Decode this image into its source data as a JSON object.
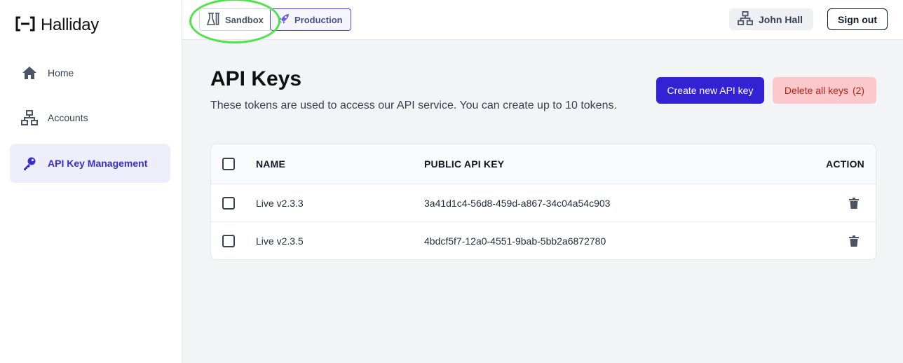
{
  "brand": {
    "name": "Halliday"
  },
  "sidebar": {
    "items": [
      {
        "label": "Home",
        "icon": "home-icon",
        "active": false
      },
      {
        "label": "Accounts",
        "icon": "network-icon",
        "active": false
      },
      {
        "label": "API Key Management",
        "icon": "key-icon",
        "active": true
      }
    ]
  },
  "topbar": {
    "env": {
      "sandbox_label": "Sandbox",
      "production_label": "Production"
    },
    "user_name": "John Hall",
    "signout_label": "Sign out"
  },
  "page": {
    "title": "API Keys",
    "subtitle": "These tokens are used to access our API service. You can create up to 10 tokens.",
    "create_label": "Create new API key",
    "delete_all_label": "Delete all keys",
    "delete_all_count": "(2)"
  },
  "table": {
    "headers": {
      "name": "NAME",
      "key": "PUBLIC API KEY",
      "action": "ACTION"
    },
    "rows": [
      {
        "name": "Live v2.3.3",
        "key": "3a41d1c4-56d8-459d-a867-34c04a54c903"
      },
      {
        "name": "Live v2.3.5",
        "key": "4bdcf5f7-12a0-4551-9bab-5bb2a6872780"
      }
    ]
  },
  "colors": {
    "accent": "#3321d4",
    "active_nav_bg": "#eeeefb",
    "danger_bg": "#fcc8cc",
    "danger_text": "#b42318",
    "highlight_ring": "#4ee34a"
  }
}
